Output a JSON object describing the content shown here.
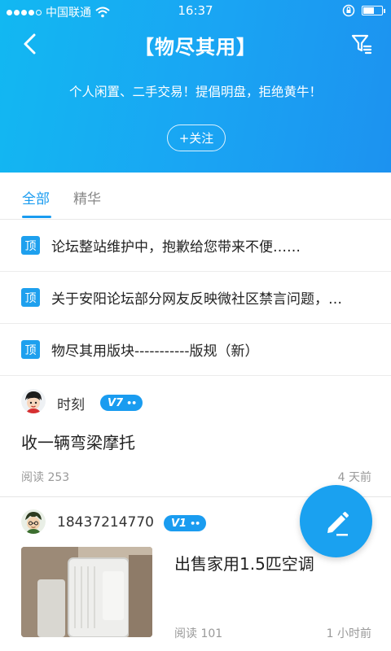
{
  "status_bar": {
    "carrier": "中国联通",
    "time": "16:37",
    "signal_icon": "signal-dots-icon",
    "wifi_icon": "wifi-icon",
    "lock_icon": "rotation-lock-icon",
    "battery_icon": "battery-icon"
  },
  "header": {
    "title": "【物尽其用】",
    "slogan": "个人闲置、二手交易！提倡明盘，拒绝黄牛！",
    "follow_label": "+关注",
    "back_icon": "chevron-left-icon",
    "filter_icon": "filter-icon",
    "colors": {
      "gradient_start": "#12b8f2",
      "gradient_end": "#1c92f0"
    }
  },
  "tabs": [
    {
      "label": "全部",
      "active": true
    },
    {
      "label": "精华",
      "active": false
    }
  ],
  "pinned": [
    {
      "badge": "顶",
      "text": "论坛整站维护中，抱歉给您带来不便……"
    },
    {
      "badge": "顶",
      "text": "关于安阳论坛部分网友反映微社区禁言问题，…"
    },
    {
      "badge": "顶",
      "text": "物尽其用版块-----------版规（新）"
    }
  ],
  "posts": [
    {
      "user": "时刻",
      "level": "V7",
      "title": "收一辆弯梁摩托",
      "reads": "阅读 253",
      "time": "4 天前",
      "avatar_icon": "cartoon-avatar-icon"
    },
    {
      "user": "18437214770",
      "level": "V1",
      "title": "出售家用1.5匹空调",
      "reads": "阅读 101",
      "time": "1 小时前",
      "avatar_icon": "cartoon-avatar-icon",
      "thumbnail": "air-conditioner-photo"
    }
  ],
  "fab": {
    "icon": "pencil-edit-icon"
  },
  "accent_color": "#1a9cf0"
}
